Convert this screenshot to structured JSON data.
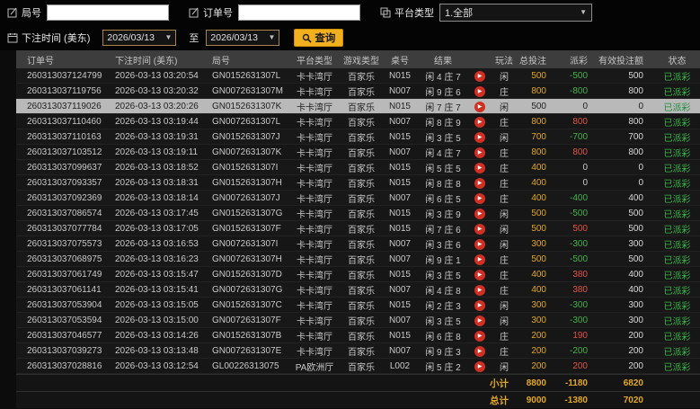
{
  "filters": {
    "round_label": "局号",
    "round_value": "",
    "order_label": "订单号",
    "order_value": "",
    "platform_label": "平台类型",
    "platform_value": "1.全部",
    "time_label": "下注时间 (美东)",
    "date_from": "2026/03/13",
    "to_label": "至",
    "date_to": "2026/03/13",
    "query_label": "查询"
  },
  "glyphs": {
    "caret": "▼",
    "play": "▶"
  },
  "colors": {
    "accent": "#e2a81f",
    "win": "#e05243",
    "loss": "#43b249",
    "status": "#3cb54a",
    "selected_row": "#b9b9b9"
  },
  "table": {
    "columns": [
      "订单号",
      "下注时间 (美东)",
      "局号",
      "平台类型",
      "游戏类型",
      "桌号",
      "结果",
      "",
      "玩法",
      "总投注",
      "派彩",
      "有效投注额",
      "状态"
    ],
    "rows": [
      {
        "order": "260313037124799",
        "time": "2026-03-13 03:20:54",
        "round": "GN0152631307L",
        "platform": "卡卡湾厅",
        "game": "百家乐",
        "table_no": "N015",
        "result": "闲 4 庄 7",
        "method": "闲",
        "total": "500",
        "payout": "-500",
        "valid": "500",
        "status": "已派彩"
      },
      {
        "order": "260313037119756",
        "time": "2026-03-13 03:20:32",
        "round": "GN0072631307M",
        "platform": "卡卡湾厅",
        "game": "百家乐",
        "table_no": "N007",
        "result": "闲 9 庄 6",
        "method": "庄",
        "total": "800",
        "payout": "-800",
        "valid": "800",
        "status": "已派彩"
      },
      {
        "order": "260313037119026",
        "time": "2026-03-13 03:20:26",
        "round": "GN0152631307K",
        "platform": "卡卡湾厅",
        "game": "百家乐",
        "table_no": "N015",
        "result": "闲 7 庄 7",
        "method": "闲",
        "total": "500",
        "payout": "0",
        "valid": "0",
        "status": "已派彩",
        "selected": true
      },
      {
        "order": "260313037110460",
        "time": "2026-03-13 03:19:44",
        "round": "GN0072631307L",
        "platform": "卡卡湾厅",
        "game": "百家乐",
        "table_no": "N007",
        "result": "闲 8 庄 9",
        "method": "庄",
        "total": "800",
        "payout": "800",
        "valid": "800",
        "status": "已派彩"
      },
      {
        "order": "260313037110163",
        "time": "2026-03-13 03:19:31",
        "round": "GN0152631307J",
        "platform": "卡卡湾厅",
        "game": "百家乐",
        "table_no": "N015",
        "result": "闲 3 庄 5",
        "method": "闲",
        "total": "700",
        "payout": "-700",
        "valid": "700",
        "status": "已派彩"
      },
      {
        "order": "260313037103512",
        "time": "2026-03-13 03:19:11",
        "round": "GN0072631307K",
        "platform": "卡卡湾厅",
        "game": "百家乐",
        "table_no": "N007",
        "result": "闲 4 庄 7",
        "method": "庄",
        "total": "800",
        "payout": "800",
        "valid": "800",
        "status": "已派彩"
      },
      {
        "order": "260313037099637",
        "time": "2026-03-13 03:18:52",
        "round": "GN0152631307I",
        "platform": "卡卡湾厅",
        "game": "百家乐",
        "table_no": "N015",
        "result": "闲 5 庄 5",
        "method": "庄",
        "total": "400",
        "payout": "0",
        "valid": "0",
        "status": "已派彩"
      },
      {
        "order": "260313037093357",
        "time": "2026-03-13 03:18:31",
        "round": "GN0152631307H",
        "platform": "卡卡湾厅",
        "game": "百家乐",
        "table_no": "N015",
        "result": "闲 8 庄 8",
        "method": "庄",
        "total": "400",
        "payout": "0",
        "valid": "0",
        "status": "已派彩"
      },
      {
        "order": "260313037092369",
        "time": "2026-03-13 03:18:14",
        "round": "GN0072631307J",
        "platform": "卡卡湾厅",
        "game": "百家乐",
        "table_no": "N007",
        "result": "闲 6 庄 5",
        "method": "庄",
        "total": "400",
        "payout": "-400",
        "valid": "400",
        "status": "已派彩"
      },
      {
        "order": "260313037086574",
        "time": "2026-03-13 03:17:45",
        "round": "GN0152631307G",
        "platform": "卡卡湾厅",
        "game": "百家乐",
        "table_no": "N015",
        "result": "闲 3 庄 9",
        "method": "闲",
        "total": "500",
        "payout": "-500",
        "valid": "500",
        "status": "已派彩"
      },
      {
        "order": "260313037077784",
        "time": "2026-03-13 03:17:05",
        "round": "GN0152631307F",
        "platform": "卡卡湾厅",
        "game": "百家乐",
        "table_no": "N015",
        "result": "闲 7 庄 6",
        "method": "闲",
        "total": "500",
        "payout": "500",
        "valid": "500",
        "status": "已派彩"
      },
      {
        "order": "260313037075573",
        "time": "2026-03-13 03:16:53",
        "round": "GN0072631307I",
        "platform": "卡卡湾厅",
        "game": "百家乐",
        "table_no": "N007",
        "result": "闲 3 庄 6",
        "method": "闲",
        "total": "300",
        "payout": "-300",
        "valid": "300",
        "status": "已派彩"
      },
      {
        "order": "260313037068975",
        "time": "2026-03-13 03:16:23",
        "round": "GN0072631307H",
        "platform": "卡卡湾厅",
        "game": "百家乐",
        "table_no": "N007",
        "result": "闲 9 庄 1",
        "method": "庄",
        "total": "500",
        "payout": "-500",
        "valid": "500",
        "status": "已派彩"
      },
      {
        "order": "260313037061749",
        "time": "2026-03-13 03:15:47",
        "round": "GN0152631307D",
        "platform": "卡卡湾厅",
        "game": "百家乐",
        "table_no": "N015",
        "result": "闲 3 庄 5",
        "method": "庄",
        "total": "400",
        "payout": "380",
        "valid": "400",
        "status": "已派彩"
      },
      {
        "order": "260313037061141",
        "time": "2026-03-13 03:15:41",
        "round": "GN0072631307G",
        "platform": "卡卡湾厅",
        "game": "百家乐",
        "table_no": "N007",
        "result": "闲 4 庄 8",
        "method": "庄",
        "total": "400",
        "payout": "380",
        "valid": "400",
        "status": "已派彩"
      },
      {
        "order": "260313037053904",
        "time": "2026-03-13 03:15:05",
        "round": "GN0152631307C",
        "platform": "卡卡湾厅",
        "game": "百家乐",
        "table_no": "N015",
        "result": "闲 2 庄 3",
        "method": "闲",
        "total": "300",
        "payout": "-300",
        "valid": "300",
        "status": "已派彩"
      },
      {
        "order": "260313037053594",
        "time": "2026-03-13 03:15:00",
        "round": "GN0072631307F",
        "platform": "卡卡湾厅",
        "game": "百家乐",
        "table_no": "N007",
        "result": "闲 3 庄 5",
        "method": "闲",
        "total": "300",
        "payout": "-300",
        "valid": "300",
        "status": "已派彩"
      },
      {
        "order": "260313037046577",
        "time": "2026-03-13 03:14:26",
        "round": "GN0152631307B",
        "platform": "卡卡湾厅",
        "game": "百家乐",
        "table_no": "N015",
        "result": "闲 6 庄 8",
        "method": "庄",
        "total": "200",
        "payout": "190",
        "valid": "200",
        "status": "已派彩"
      },
      {
        "order": "260313037039273",
        "time": "2026-03-13 03:13:48",
        "round": "GN0072631307E",
        "platform": "卡卡湾厅",
        "game": "百家乐",
        "table_no": "N007",
        "result": "闲 9 庄 3",
        "method": "庄",
        "total": "200",
        "payout": "-200",
        "valid": "200",
        "status": "已派彩"
      },
      {
        "order": "260313037028816",
        "time": "2026-03-13 03:12:54",
        "round": "GL00226313075",
        "platform": "PA欧洲厅",
        "game": "百家乐",
        "table_no": "L002",
        "result": "闲 5 庄 2",
        "method": "闲",
        "total": "200",
        "payout": "200",
        "valid": "200",
        "status": "已派彩"
      }
    ],
    "subtotal": {
      "label": "小计",
      "total": "8800",
      "payout": "-1180",
      "valid": "6820"
    },
    "grand_total": {
      "label": "总计",
      "total": "9000",
      "payout": "-1380",
      "valid": "7020"
    }
  }
}
